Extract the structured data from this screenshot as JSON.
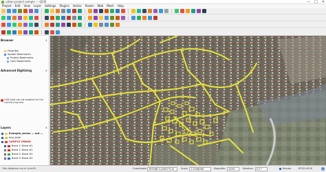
{
  "window": {
    "title": "urban-project sample — QGIS",
    "controls": [
      "—",
      "□",
      "✕"
    ]
  },
  "menu": [
    "Project",
    "Edit",
    "View",
    "Layer",
    "Settings",
    "Plugins",
    "Vector",
    "Raster",
    "Web",
    "Mesh",
    "Help"
  ],
  "toolbars": {
    "row1_colors": [
      "#f2c94c",
      "#4a90d9",
      "#4a90d9",
      "#6b8e23",
      "#d35400",
      "#9b59b6",
      "#4a90d9",
      "#27ae60",
      "#f2c94c",
      "#e67e22",
      "#7f8c8d",
      "#3498db",
      "#c0392b",
      "#16a085",
      "#f39c12",
      "#8e44ad",
      "#2c3e50",
      "#d35400",
      "#27ae60",
      "#2980b9",
      "#e74c3c",
      "#f1c40f",
      "#1abc9c",
      "#34495e",
      "#e67e22",
      "#9b59b6",
      "#3498db",
      "#95a5a6",
      "#2ecc71",
      "#e74c3c",
      "#f39c12",
      "#16a085",
      "#8e44ad",
      "#2c3e50"
    ],
    "row2_colors": [
      "#2ecc71",
      "#3498db",
      "#e67e22",
      "#9b59b6",
      "#f1c40f",
      "#1abc9c",
      "#e74c3c",
      "#34495e",
      "#d35400",
      "#27ae60",
      "#2980b9",
      "#c0392b",
      "#7f8c8d",
      "#16a085",
      "#f39c12",
      "#8e44ad",
      "#f2c94c",
      "#4a90d9",
      "#6b8e23",
      "#d35400",
      "#9b59b6",
      "#4a90d9",
      "#27ae60",
      "#e67e22",
      "#3498db",
      "#c0392b"
    ],
    "row3_colors": [
      "#e74c3c",
      "#3498db",
      "#2ecc71",
      "#f39c12",
      "#9b59b6",
      "#1abc9c",
      "#34495e",
      "#e67e22",
      "#c0392b",
      "#16a085",
      "#8e44ad",
      "#2c3e50",
      "#d35400",
      "#27ae60",
      "#2980b9",
      "#f1c40f",
      "#7f8c8d",
      "#4a90d9",
      "#6b8e23",
      "#e67e22"
    ],
    "row4_colors": [
      "#c0392b",
      "#27ae60",
      "#2980b9",
      "#f39c12",
      "#8e44ad",
      "#16a085",
      "#d35400",
      "#34495e",
      "#e74c3c",
      "#3498db"
    ]
  },
  "browser": {
    "title": "Browser",
    "items": [
      "Favorites",
      "Spatial Bookmarks",
      "Project Bookmarks",
      "User Bookmarks"
    ]
  },
  "digitizing": {
    "title": "Advanced Digitizing",
    "message": "CAD tools are not enabled for the current map tool"
  },
  "layers": {
    "title": "Layers",
    "items": [
      {
        "name": "Example_sector — out —",
        "color": "#e8d24a",
        "checked": true
      },
      {
        "name": "ecw_total",
        "color": "#d9c63a",
        "checked": true
      },
      {
        "name": "SAMPLE URBAN",
        "color": "#e03a3a",
        "checked": true
      },
      {
        "name": "Band 1: Band #1",
        "color": "#d0312d",
        "checked": true
      },
      {
        "name": "Band 1: Band #1",
        "color": "#d0312d",
        "checked": false
      },
      {
        "name": "Band 2: Band #1",
        "color": "#2db34a",
        "checked": false
      },
      {
        "name": "Band 3: Band #1",
        "color": "#2f5fd0",
        "checked": false
      }
    ]
  },
  "status": {
    "hint": "Pan distance run in (run:R)",
    "coordinate_label": "Coordinate",
    "coordinate": "393768.3,4765771.8",
    "scale_label": "Scale",
    "scale": "1:3298096",
    "magnifier_label": "Magnifier",
    "magnifier": "100%",
    "rotation_label": "Rotation",
    "rotation": "0.0 °",
    "render_label": "Render",
    "crs": "EPSG:4326"
  }
}
